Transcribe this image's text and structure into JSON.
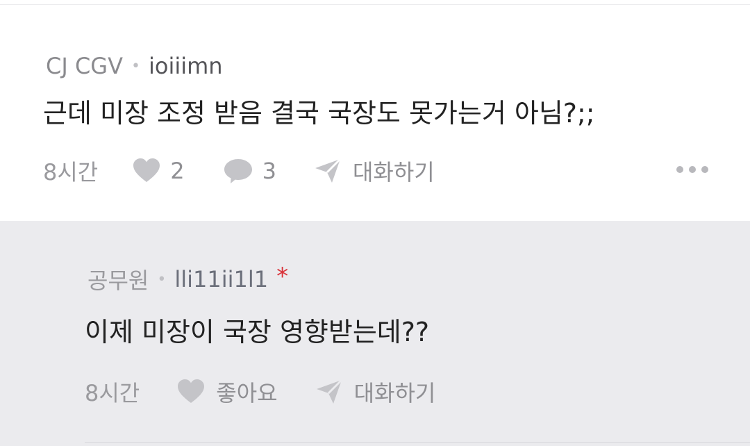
{
  "comment": {
    "company": "CJ CGV",
    "separator": "•",
    "author": "ioiiimn",
    "text": "근데 미장 조정 받음 결국 국장도 못가는거 아님?;;",
    "time": "8시간",
    "likes": "2",
    "replies": "3",
    "dm_label": "대화하기"
  },
  "reply": {
    "company": "공무원",
    "separator": "•",
    "author": "lli11ii1l1",
    "marker": "*",
    "text": "이제 미장이 국장 영향받는데??",
    "time": "8시간",
    "like_label": "좋아요",
    "dm_label": "대화하기"
  },
  "colors": {
    "reply_background": "#ebebee",
    "marker": "#d9343b",
    "icon": "#c4c4c8"
  },
  "icons": [
    "heart-icon",
    "comment-bubble-icon",
    "paper-plane-icon",
    "more-dots-icon"
  ]
}
